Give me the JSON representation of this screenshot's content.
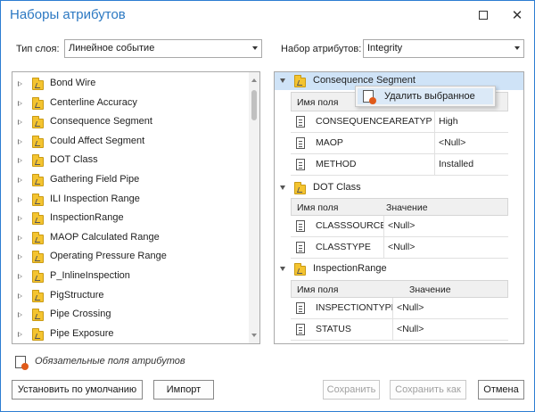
{
  "window": {
    "title": "Наборы атрибутов",
    "maximize_icon": "maximize-icon",
    "close_icon": "close-icon"
  },
  "layer_type": {
    "label": "Тип слоя:",
    "value": "Линейное событие"
  },
  "attribute_set": {
    "label": "Набор атрибутов:",
    "value": "Integrity"
  },
  "left_list": [
    "Bond Wire",
    "Centerline Accuracy",
    "Consequence Segment",
    "Could Affect Segment",
    "DOT Class",
    "Gathering Field Pipe",
    "ILI Inspection Range",
    "InspectionRange",
    "MAOP Calculated Range",
    "Operating Pressure Range",
    "P_InlineInspection",
    "PigStructure",
    "Pipe Crossing",
    "Pipe Exposure"
  ],
  "groups": [
    {
      "name": "Consequence Segment",
      "headers": [
        "Имя поля",
        ""
      ],
      "rows": [
        {
          "field": "CONSEQUENCEAREATYPE",
          "value": "High"
        },
        {
          "field": "MAOP",
          "value": "<Null>"
        },
        {
          "field": "METHOD",
          "value": "Installed"
        }
      ]
    },
    {
      "name": "DOT Class",
      "headers": [
        "Имя поля",
        "Значение"
      ],
      "rows": [
        {
          "field": "CLASSSOURCE",
          "value": "<Null>"
        },
        {
          "field": "CLASSTYPE",
          "value": "<Null>"
        }
      ]
    },
    {
      "name": "InspectionRange",
      "headers": [
        "Имя поля",
        "Значение"
      ],
      "rows": [
        {
          "field": "INSPECTIONTYPE",
          "value": "<Null>"
        },
        {
          "field": "STATUS",
          "value": "<Null>"
        }
      ]
    }
  ],
  "context_menu": {
    "item": "Удалить выбранное"
  },
  "footer": {
    "required_note": "Обязательные поля атрибутов",
    "set_default": "Установить по умолчанию",
    "import": "Импорт",
    "save": "Сохранить",
    "save_as": "Сохранить как",
    "cancel": "Отмена"
  }
}
